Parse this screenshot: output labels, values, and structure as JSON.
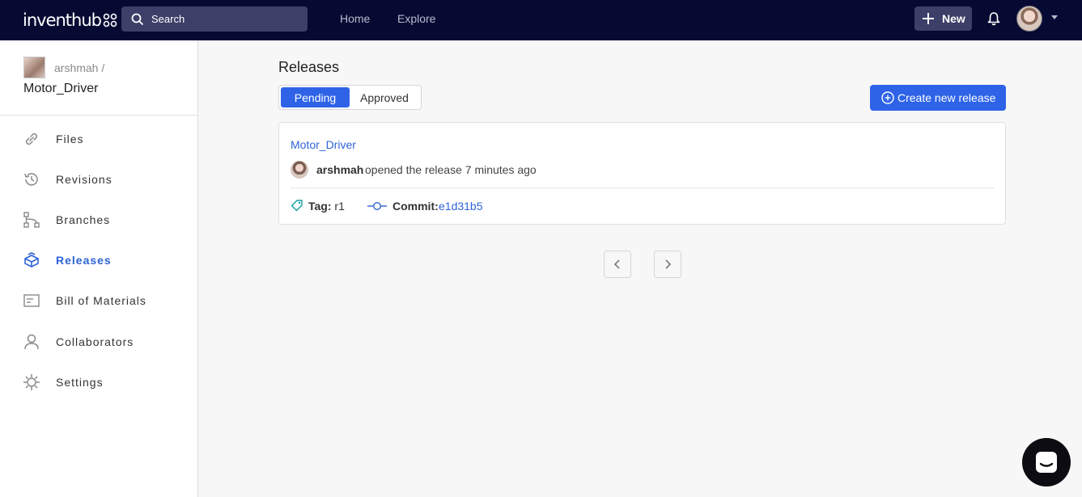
{
  "topbar": {
    "logo_text": "inventhub",
    "search_placeholder": "Search",
    "nav": [
      "Home",
      "Explore"
    ],
    "new_label": "New"
  },
  "sidebar": {
    "owner": "arshmah /",
    "repo": "Motor_Driver",
    "items": [
      {
        "label": "Files",
        "icon": "link-icon"
      },
      {
        "label": "Revisions",
        "icon": "history-icon"
      },
      {
        "label": "Branches",
        "icon": "branches-icon"
      },
      {
        "label": "Releases",
        "icon": "box-icon",
        "active": true
      },
      {
        "label": "Bill of Materials",
        "icon": "list-icon"
      },
      {
        "label": "Collaborators",
        "icon": "person-icon"
      },
      {
        "label": "Settings",
        "icon": "gear-icon"
      }
    ]
  },
  "main": {
    "title": "Releases",
    "tabs": [
      {
        "label": "Pending",
        "active": true
      },
      {
        "label": "Approved",
        "active": false
      }
    ],
    "create_label": "Create new release",
    "release": {
      "title": "Motor_Driver",
      "user": "arshmah",
      "action": "opened the release 7 minutes ago",
      "tag_label": "Tag:",
      "tag_value": "r1",
      "commit_label": "Commit:",
      "commit_hash": "e1d31b5"
    }
  },
  "colors": {
    "topbar": "#060a33",
    "accent": "#2e63e8",
    "link": "#2e63d8"
  }
}
